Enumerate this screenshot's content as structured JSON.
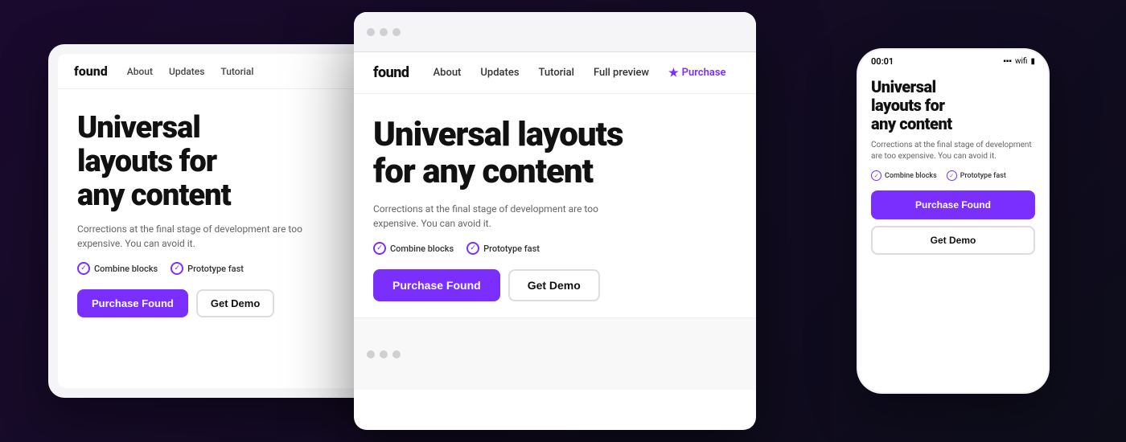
{
  "brand": {
    "name": "found"
  },
  "nav": {
    "logo": "found",
    "links": [
      "About",
      "Updates",
      "Tutorial",
      "Full preview"
    ],
    "purchase_label": "Purchase",
    "purchase_icon": "★"
  },
  "hero": {
    "title_line1": "Universal layouts for",
    "title_line2": "any content",
    "subtitle": "Corrections at the final stage of development are too expensive. You can avoid it.",
    "features": [
      "Combine blocks",
      "Prototype fast"
    ],
    "cta_primary": "Purchase Found",
    "cta_secondary": "Get Demo"
  },
  "phone": {
    "time": "00:01",
    "signal": "▪▪▪",
    "wifi": "▾",
    "battery": "▮▮▮"
  }
}
